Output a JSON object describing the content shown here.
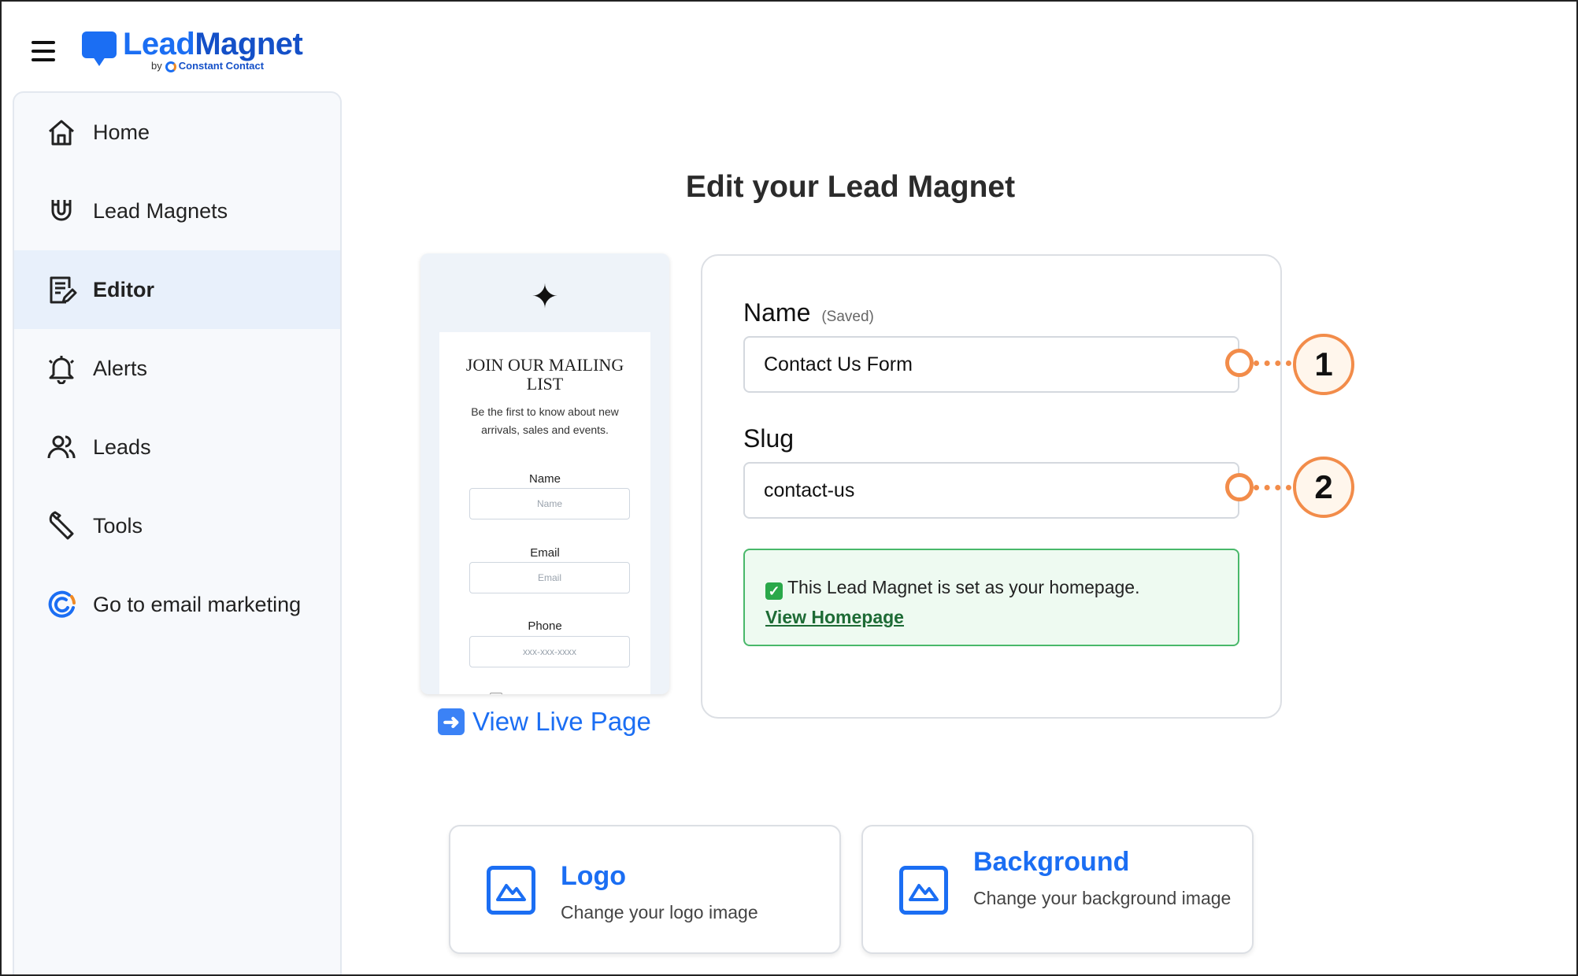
{
  "header": {
    "menu_icon": "hamburger-menu-icon",
    "logo_main": "Lead",
    "logo_accent": "Magnet",
    "logo_by": "by",
    "logo_partner": "Constant Contact"
  },
  "sidebar": {
    "items": [
      {
        "label": "Home",
        "icon": "home-icon"
      },
      {
        "label": "Lead Magnets",
        "icon": "magnet-icon"
      },
      {
        "label": "Editor",
        "icon": "edit-document-icon",
        "active": true
      },
      {
        "label": "Alerts",
        "icon": "bell-icon"
      },
      {
        "label": "Leads",
        "icon": "users-icon"
      },
      {
        "label": "Tools",
        "icon": "wrench-icon"
      },
      {
        "label": "Go to email marketing",
        "icon": "constant-contact-icon"
      }
    ]
  },
  "main": {
    "title": "Edit your Lead Magnet",
    "preview": {
      "star": "✦",
      "heading": "JOIN OUR MAILING LIST",
      "subtitle": "Be the first to know about new arrivals, sales and events.",
      "fields": [
        {
          "label": "Name",
          "placeholder": "Name"
        },
        {
          "label": "Email",
          "placeholder": "Email"
        },
        {
          "label": "Phone",
          "placeholder": "xxx-xxx-xxxx"
        }
      ]
    },
    "live_link": "View Live Page",
    "form": {
      "name_label": "Name",
      "name_status": "(Saved)",
      "name_value": "Contact Us Form",
      "slug_label": "Slug",
      "slug_value": "contact-us",
      "notice_text": "This Lead Magnet is set as your homepage.",
      "notice_link": "View Homepage"
    },
    "callouts": [
      "1",
      "2"
    ],
    "tiles": [
      {
        "title": "Logo",
        "description": "Change your logo image",
        "icon": "image-icon"
      },
      {
        "title": "Background",
        "description": "Change your background image",
        "icon": "image-icon"
      }
    ]
  },
  "colors": {
    "brand": "#1b6ef3",
    "callout": "#f28c4a",
    "success": "#49b86a",
    "active_nav": "#e8f0fb"
  }
}
